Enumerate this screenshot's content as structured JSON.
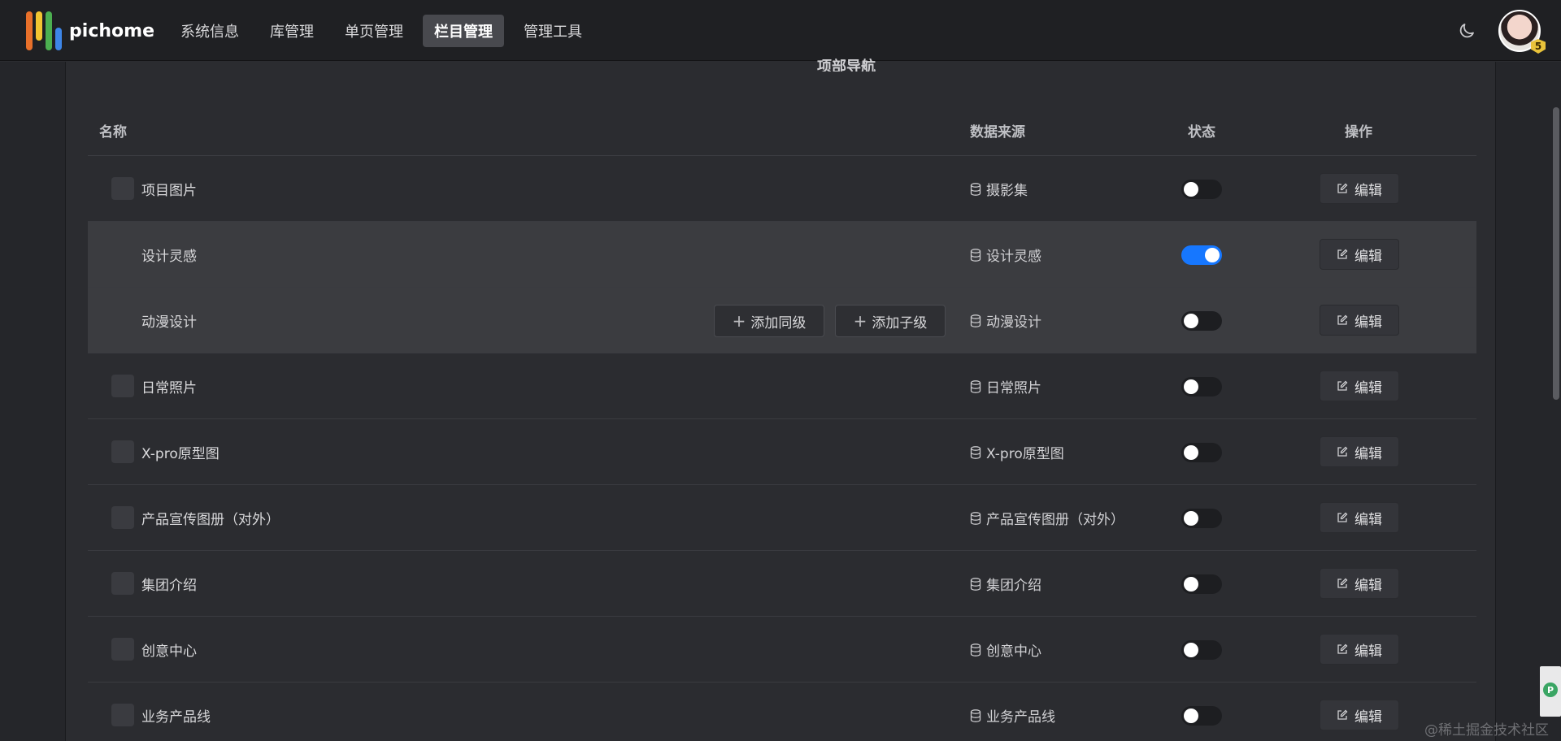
{
  "brand": {
    "name": "pichome"
  },
  "nav": {
    "items": [
      {
        "label": "系统信息",
        "active": false
      },
      {
        "label": "库管理",
        "active": false
      },
      {
        "label": "单页管理",
        "active": false
      },
      {
        "label": "栏目管理",
        "active": true
      },
      {
        "label": "管理工具",
        "active": false
      }
    ]
  },
  "user": {
    "badge_level": "5"
  },
  "panel": {
    "title": "项部导航"
  },
  "table": {
    "headers": {
      "name": "名称",
      "source": "数据来源",
      "status": "状态",
      "actions": "操作"
    },
    "rows": [
      {
        "name": "项目图片",
        "source": "摄影集",
        "status_on": false,
        "edit_label": "编辑",
        "has_check": true,
        "selected": false
      },
      {
        "name": "设计灵感",
        "source": "设计灵感",
        "status_on": true,
        "edit_label": "编辑",
        "has_check": false,
        "selected": true
      },
      {
        "name": "动漫设计",
        "source": "动漫设计",
        "status_on": false,
        "edit_label": "编辑",
        "has_check": false,
        "selected": true,
        "add_sibling": "添加同级",
        "add_child": "添加子级"
      },
      {
        "name": "日常照片",
        "source": "日常照片",
        "status_on": false,
        "edit_label": "编辑",
        "has_check": true,
        "selected": false
      },
      {
        "name": "X-pro原型图",
        "source": "X-pro原型图",
        "status_on": false,
        "edit_label": "编辑",
        "has_check": true,
        "selected": false
      },
      {
        "name": "产品宣传图册（对外）",
        "source": "产品宣传图册（对外）",
        "status_on": false,
        "edit_label": "编辑",
        "has_check": true,
        "selected": false
      },
      {
        "name": "集团介绍",
        "source": "集团介绍",
        "status_on": false,
        "edit_label": "编辑",
        "has_check": true,
        "selected": false
      },
      {
        "name": "创意中心",
        "source": "创意中心",
        "status_on": false,
        "edit_label": "编辑",
        "has_check": true,
        "selected": false
      },
      {
        "name": "业务产品线",
        "source": "业务产品线",
        "status_on": false,
        "edit_label": "编辑",
        "has_check": true,
        "selected": false
      }
    ]
  },
  "watermark": "@稀土掘金技术社区",
  "colors": {
    "toggle_on": "#1677ff",
    "background": "#2b2c30",
    "topbar": "#1f2023"
  },
  "icons": {
    "theme_toggle": "moon-icon",
    "source": "database-icon",
    "edit": "edit-icon",
    "add": "plus-icon"
  }
}
